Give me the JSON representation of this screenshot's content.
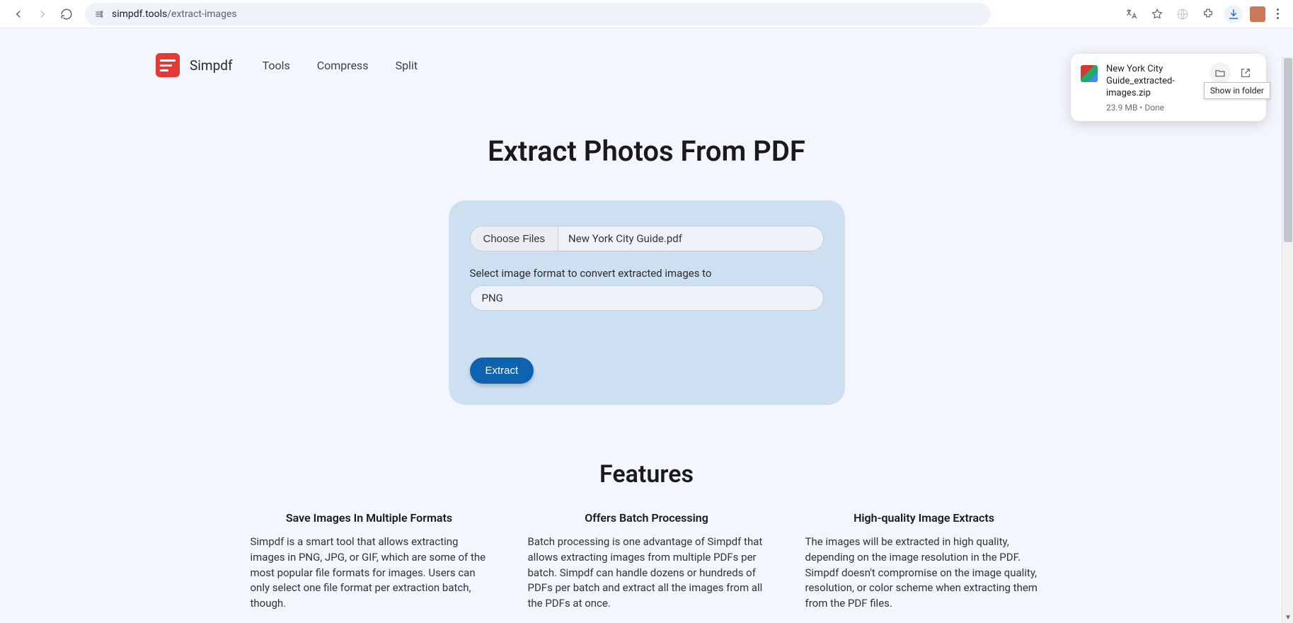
{
  "browser": {
    "url_domain": "simpdf.tools",
    "url_path": "/extract-images"
  },
  "download": {
    "title": "New York City Guide_extracted-images.zip",
    "meta": "23.9 MB • Done",
    "tooltip": "Show in folder"
  },
  "header": {
    "brand": "Simpdf",
    "nav": [
      "Tools",
      "Compress",
      "Split"
    ]
  },
  "hero": {
    "title": "Extract Photos From PDF"
  },
  "panel": {
    "choose_label": "Choose Files",
    "file_name": "New York City Guide.pdf",
    "format_label": "Select image format to convert extracted images to",
    "format_value": "PNG",
    "extract_label": "Extract"
  },
  "features": {
    "heading": "Features",
    "items": [
      {
        "title": "Save Images In Multiple Formats",
        "body": "Simpdf is a smart tool that allows extracting images in PNG, JPG, or GIF, which are some of the most popular file formats for images. Users can only select one file format per extraction batch, though."
      },
      {
        "title": "Offers Batch Processing",
        "body": "Batch processing is one advantage of Simpdf that allows extracting images from multiple PDFs per batch. Simpdf can handle dozens or hundreds of PDFs per batch and extract all the images from all the PDFs at once."
      },
      {
        "title": "High-quality Image Extracts",
        "body": "The images will be extracted in high quality, depending on the image resolution in the PDF. Simpdf doesn't compromise on the image quality, resolution, or color scheme when extracting them from the PDF files."
      }
    ]
  }
}
